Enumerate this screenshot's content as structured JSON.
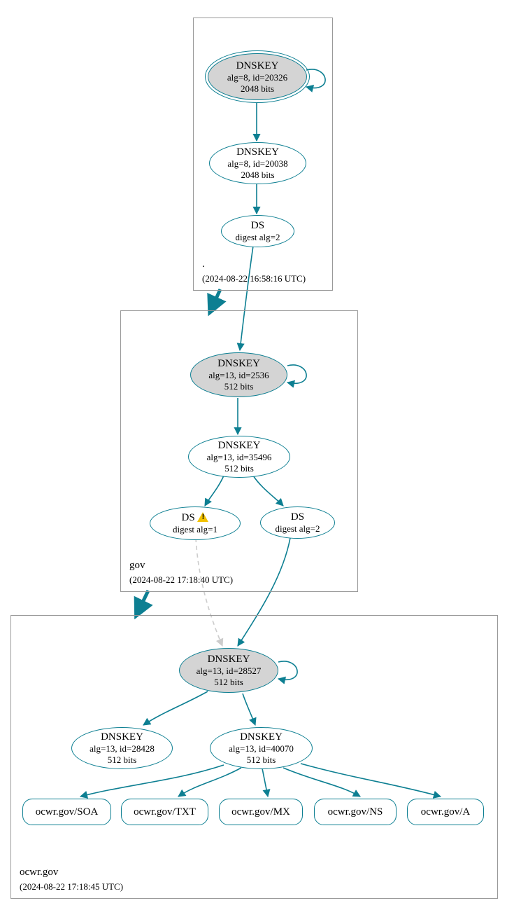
{
  "zones": {
    "root": {
      "label": ".",
      "time": "(2024-08-22 16:58:16 UTC)",
      "nodes": {
        "ksk": {
          "title": "DNSKEY",
          "sub1": "alg=8, id=20326",
          "sub2": "2048 bits"
        },
        "zsk": {
          "title": "DNSKEY",
          "sub1": "alg=8, id=20038",
          "sub2": "2048 bits"
        },
        "ds": {
          "title": "DS",
          "sub1": "digest alg=2"
        }
      }
    },
    "gov": {
      "label": "gov",
      "time": "(2024-08-22 17:18:40 UTC)",
      "nodes": {
        "ksk": {
          "title": "DNSKEY",
          "sub1": "alg=13, id=2536",
          "sub2": "512 bits"
        },
        "zsk": {
          "title": "DNSKEY",
          "sub1": "alg=13, id=35496",
          "sub2": "512 bits"
        },
        "ds1": {
          "title": "DS",
          "sub1": "digest alg=1"
        },
        "ds2": {
          "title": "DS",
          "sub1": "digest alg=2"
        }
      }
    },
    "ocwr": {
      "label": "ocwr.gov",
      "time": "(2024-08-22 17:18:45 UTC)",
      "nodes": {
        "ksk": {
          "title": "DNSKEY",
          "sub1": "alg=13, id=28527",
          "sub2": "512 bits"
        },
        "zskA": {
          "title": "DNSKEY",
          "sub1": "alg=13, id=28428",
          "sub2": "512 bits"
        },
        "zskB": {
          "title": "DNSKEY",
          "sub1": "alg=13, id=40070",
          "sub2": "512 bits"
        }
      },
      "records": {
        "soa": "ocwr.gov/SOA",
        "txt": "ocwr.gov/TXT",
        "mx": "ocwr.gov/MX",
        "ns": "ocwr.gov/NS",
        "a": "ocwr.gov/A"
      }
    }
  }
}
